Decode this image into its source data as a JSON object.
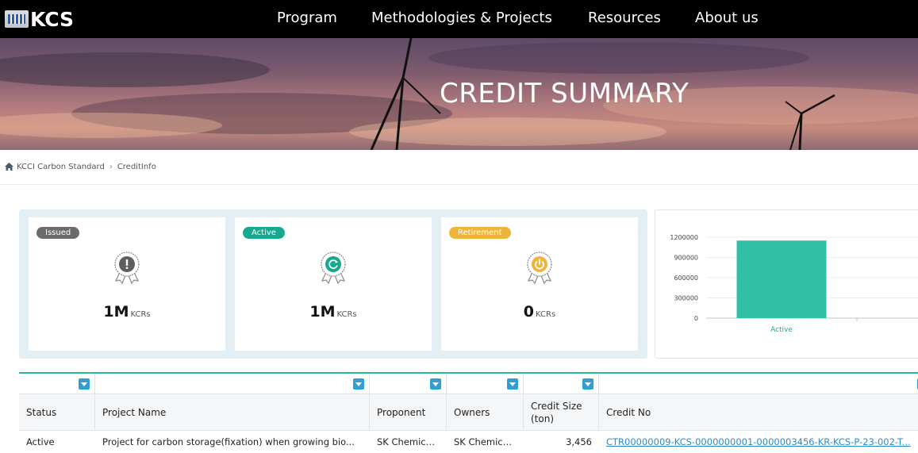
{
  "nav": {
    "logo_text": "KCS",
    "links": [
      "Program",
      "Methodologies & Projects",
      "Resources",
      "About us"
    ]
  },
  "hero": {
    "title": "CREDIT SUMMARY"
  },
  "breadcrumb": {
    "items": [
      "KCCI Carbon Standard",
      "CreditInfo"
    ]
  },
  "cards": [
    {
      "badge": "Issued",
      "badge_color": "#6b6b6b",
      "value": "1M",
      "unit": "KCRs",
      "icon": "issued-medal-icon",
      "icon_color": "#5f5f5f"
    },
    {
      "badge": "Active",
      "badge_color": "#17a88e",
      "value": "1M",
      "unit": "KCRs",
      "icon": "active-medal-icon",
      "icon_color": "#17a88e"
    },
    {
      "badge": "Retirement",
      "badge_color": "#f0b43a",
      "value": "0",
      "unit": "KCRs",
      "icon": "retirement-medal-icon",
      "icon_color": "#f0b43a"
    }
  ],
  "chart_data": {
    "type": "bar",
    "categories": [
      "Active"
    ],
    "values": [
      1150000
    ],
    "title": "",
    "xlabel": "",
    "ylabel": "",
    "ylim": [
      0,
      1200000
    ],
    "yticks": [
      0,
      300000,
      600000,
      900000,
      1200000
    ],
    "bar_color": "#2ebfa5",
    "grid": true
  },
  "table": {
    "columns": [
      "Status",
      "Project Name",
      "Proponent",
      "Owners",
      "Credit Size (ton)",
      "Credit No"
    ],
    "rows": [
      [
        "Active",
        "Project for carbon storage(fixation) when growing bio...",
        "SK Chemica...",
        "SK Chemica...",
        "3,456",
        "CTR00000009-KCS-0000000001-0000003456-KR-KCS-P-23-002-T..."
      ]
    ]
  },
  "colors": {
    "accent": "#27b8a3",
    "filter": "#2f9fd6",
    "link": "#2b8bc9"
  }
}
